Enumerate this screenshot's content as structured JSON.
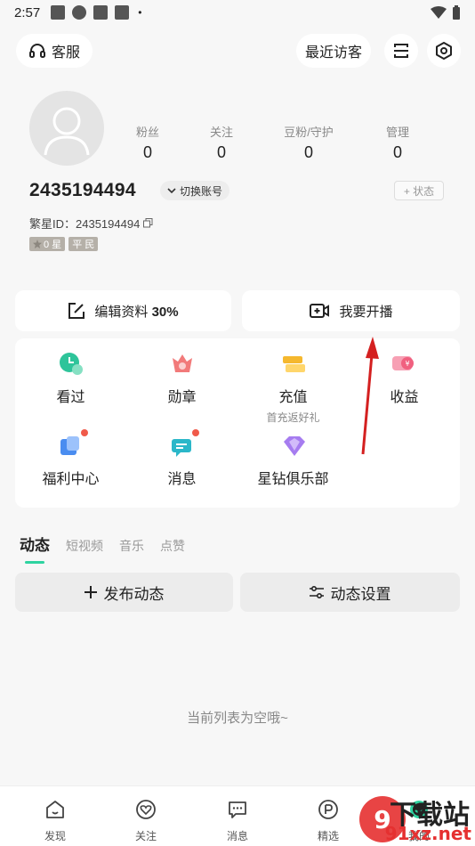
{
  "status_bar": {
    "time": "2:57",
    "dot": "•"
  },
  "header": {
    "service_label": "客服",
    "visitors_label": "最近访客"
  },
  "profile": {
    "stats": [
      {
        "label": "粉丝",
        "value": "0"
      },
      {
        "label": "关注",
        "value": "0"
      },
      {
        "label": "豆粉/守护",
        "value": "0"
      },
      {
        "label": "管理",
        "value": "0"
      }
    ],
    "user_id": "2435194494",
    "switch_account": "切换账号",
    "status_label": "+ 状态",
    "star_id_label": "繁星ID：2435194494",
    "badges": [
      "0 星",
      "平 民"
    ]
  },
  "actions": {
    "edit_profile": "编辑资料",
    "edit_percent": "30%",
    "go_live": "我要开播"
  },
  "grid": [
    {
      "label": "看过",
      "sub": ""
    },
    {
      "label": "勋章",
      "sub": ""
    },
    {
      "label": "充值",
      "sub": "首充返好礼"
    },
    {
      "label": "收益",
      "sub": ""
    },
    {
      "label": "福利中心",
      "sub": ""
    },
    {
      "label": "消息",
      "sub": ""
    },
    {
      "label": "星钻俱乐部",
      "sub": ""
    }
  ],
  "tabs": [
    "动态",
    "短视频",
    "音乐",
    "点赞"
  ],
  "feed": {
    "publish": "发布动态",
    "settings": "动态设置",
    "empty": "当前列表为空哦~"
  },
  "bottom_nav": [
    "发现",
    "关注",
    "消息",
    "精选",
    "我的"
  ],
  "watermark": {
    "text1": "下载站",
    "text2": "91xz.net"
  },
  "colors": {
    "accent": "#2ed3a0",
    "arrow": "#d42020",
    "red_dot": "#f05a4a"
  }
}
